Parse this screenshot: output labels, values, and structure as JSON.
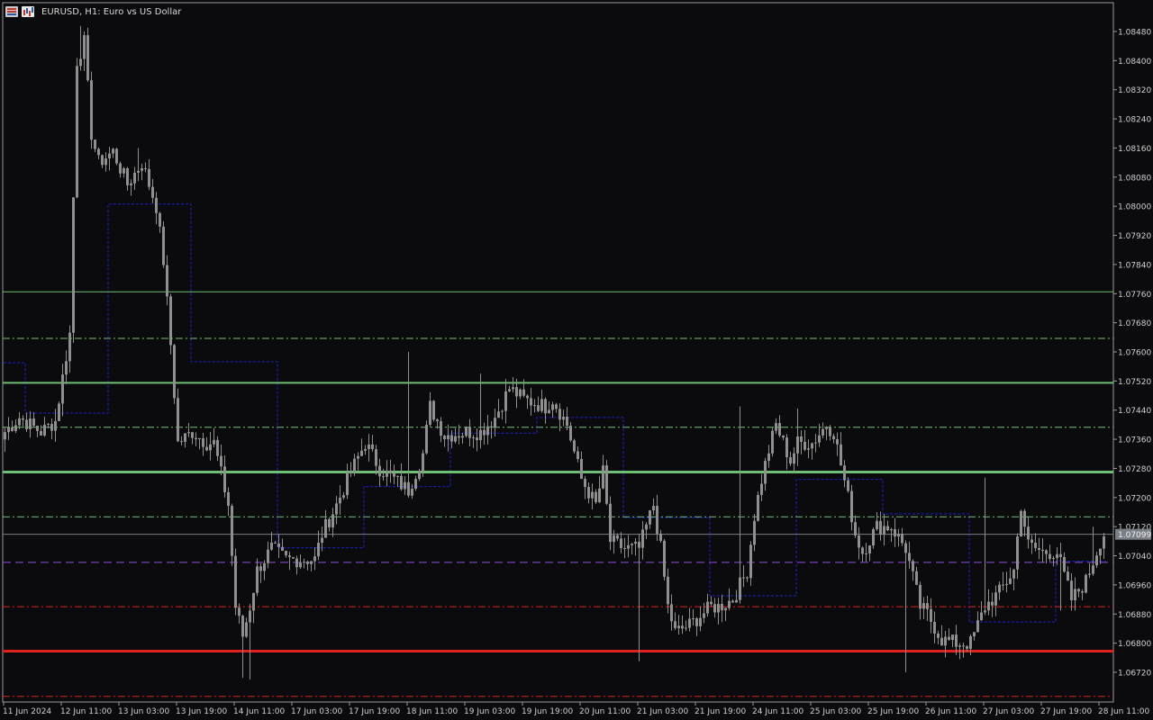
{
  "header": {
    "title": "EURUSD, H1:  Euro vs US Dollar",
    "icons": [
      "list-icon",
      "chart-icon"
    ]
  },
  "colors": {
    "background": "#0b0b0e",
    "axis": "#9a9a9a",
    "text": "#cfcfcf",
    "candle": "#8f8f8f",
    "channel": "#1c22c8",
    "green": "#6fbf73",
    "red": "#e0211d",
    "purple": "#8b4fd6",
    "current_price_line": "#7a7f86"
  },
  "chart_data": {
    "type": "candlestick",
    "symbol": "EURUSD",
    "timeframe": "H1",
    "title": "EURUSD, H1:  Euro vs US Dollar",
    "ylim": [
      1.0666,
      1.0852
    ],
    "y_ticks": [
      "1.08480",
      "1.08400",
      "1.08320",
      "1.08240",
      "1.08160",
      "1.08080",
      "1.08000",
      "1.07920",
      "1.07840",
      "1.07760",
      "1.07680",
      "1.07600",
      "1.07520",
      "1.07440",
      "1.07360",
      "1.07280",
      "1.07200",
      "1.07120",
      "1.07040",
      "1.06960",
      "1.06880",
      "1.06800",
      "1.06720"
    ],
    "x_labels": [
      "11 Jun 2024",
      "12 Jun 11:00",
      "13 Jun 03:00",
      "13 Jun 19:00",
      "14 Jun 11:00",
      "17 Jun 03:00",
      "17 Jun 19:00",
      "18 Jun 11:00",
      "19 Jun 03:00",
      "19 Jun 19:00",
      "20 Jun 11:00",
      "21 Jun 03:00",
      "21 Jun 19:00",
      "24 Jun 11:00",
      "25 Jun 03:00",
      "25 Jun 19:00",
      "26 Jun 11:00",
      "27 Jun 03:00",
      "27 Jun 19:00",
      "28 Jun 11:00"
    ],
    "bars_per_label": 16,
    "total_bars": 306,
    "current_price": 1.07099,
    "current_price_label": "1.07099",
    "levels": [
      {
        "price": 1.07765,
        "color": "#6fbf73",
        "style": "solid",
        "width": 1
      },
      {
        "price": 1.07637,
        "color": "#6fbf73",
        "style": "dashdot",
        "width": 1
      },
      {
        "price": 1.07515,
        "color": "#6fbf73",
        "style": "solid",
        "width": 2
      },
      {
        "price": 1.07393,
        "color": "#6fbf73",
        "style": "dashdot",
        "width": 1
      },
      {
        "price": 1.0727,
        "color": "#6fbf73",
        "style": "solid",
        "width": 3
      },
      {
        "price": 1.07147,
        "color": "#6fbf73",
        "style": "dashdot",
        "width": 1
      },
      {
        "price": 1.07022,
        "color": "#8b4fd6",
        "style": "dashed",
        "width": 1
      },
      {
        "price": 1.069,
        "color": "#e0211d",
        "style": "dashdot",
        "width": 1
      },
      {
        "price": 1.06778,
        "color": "#e0211d",
        "style": "solid",
        "width": 3
      },
      {
        "price": 1.06654,
        "color": "#e0211d",
        "style": "dashdot",
        "width": 1
      }
    ],
    "channel_steps": [
      {
        "from_bar": 0,
        "to_bar": 6,
        "price": 1.0757
      },
      {
        "from_bar": 6,
        "to_bar": 29,
        "price": 1.07432
      },
      {
        "from_bar": 29,
        "to_bar": 52,
        "price": 1.08006
      },
      {
        "from_bar": 52,
        "to_bar": 76,
        "price": 1.07573
      },
      {
        "from_bar": 76,
        "to_bar": 100,
        "price": 1.07062
      },
      {
        "from_bar": 100,
        "to_bar": 124,
        "price": 1.0723
      },
      {
        "from_bar": 124,
        "to_bar": 148,
        "price": 1.07377
      },
      {
        "from_bar": 148,
        "to_bar": 172,
        "price": 1.0742
      },
      {
        "from_bar": 172,
        "to_bar": 196,
        "price": 1.07145
      },
      {
        "from_bar": 196,
        "to_bar": 220,
        "price": 1.0693
      },
      {
        "from_bar": 220,
        "to_bar": 244,
        "price": 1.0725
      },
      {
        "from_bar": 244,
        "to_bar": 268,
        "price": 1.07155
      },
      {
        "from_bar": 268,
        "to_bar": 292,
        "price": 1.06858
      },
      {
        "from_bar": 292,
        "to_bar": 306,
        "price": 1.07025
      }
    ],
    "price_path": [
      [
        0,
        1.0738
      ],
      [
        4,
        1.0742
      ],
      [
        10,
        1.0738
      ],
      [
        14,
        1.0741
      ],
      [
        18,
        1.0765
      ],
      [
        20,
        1.084
      ],
      [
        22,
        1.0845
      ],
      [
        24,
        1.082
      ],
      [
        26,
        1.0812
      ],
      [
        30,
        1.0815
      ],
      [
        34,
        1.0806
      ],
      [
        38,
        1.0812
      ],
      [
        42,
        1.08
      ],
      [
        44,
        1.0785
      ],
      [
        46,
        1.0762
      ],
      [
        48,
        1.0735
      ],
      [
        52,
        1.0738
      ],
      [
        56,
        1.0735
      ],
      [
        58,
        1.0735
      ],
      [
        62,
        1.0718
      ],
      [
        64,
        1.069
      ],
      [
        66,
        1.0682
      ],
      [
        68,
        1.069
      ],
      [
        70,
        1.07
      ],
      [
        74,
        1.0706
      ],
      [
        78,
        1.0703
      ],
      [
        82,
        1.0703
      ],
      [
        86,
        1.0703
      ],
      [
        88,
        1.071
      ],
      [
        92,
        1.0718
      ],
      [
        96,
        1.0727
      ],
      [
        100,
        1.0735
      ],
      [
        104,
        1.0728
      ],
      [
        108,
        1.0725
      ],
      [
        112,
        1.0722
      ],
      [
        116,
        1.0732
      ],
      [
        118,
        1.0745
      ],
      [
        122,
        1.0737
      ],
      [
        128,
        1.0738
      ],
      [
        132,
        1.0738
      ],
      [
        136,
        1.0742
      ],
      [
        140,
        1.075
      ],
      [
        144,
        1.0747
      ],
      [
        150,
        1.0745
      ],
      [
        152,
        1.0747
      ],
      [
        156,
        1.074
      ],
      [
        160,
        1.0725
      ],
      [
        164,
        1.0718
      ],
      [
        166,
        1.0727
      ],
      [
        168,
        1.0708
      ],
      [
        172,
        1.0706
      ],
      [
        176,
        1.0706
      ],
      [
        178,
        1.0712
      ],
      [
        180,
        1.0718
      ],
      [
        182,
        1.0706
      ],
      [
        184,
        1.069
      ],
      [
        186,
        1.0683
      ],
      [
        190,
        1.0685
      ],
      [
        196,
        1.069
      ],
      [
        198,
        1.069
      ],
      [
        202,
        1.0692
      ],
      [
        206,
        1.07
      ],
      [
        208,
        1.0715
      ],
      [
        210,
        1.0725
      ],
      [
        212,
        1.0733
      ],
      [
        214,
        1.074
      ],
      [
        216,
        1.0735
      ],
      [
        218,
        1.073
      ],
      [
        220,
        1.0735
      ],
      [
        224,
        1.0735
      ],
      [
        228,
        1.074
      ],
      [
        230,
        1.0738
      ],
      [
        234,
        1.072
      ],
      [
        236,
        1.071
      ],
      [
        238,
        1.0705
      ],
      [
        242,
        1.0712
      ],
      [
        246,
        1.0712
      ],
      [
        250,
        1.0706
      ],
      [
        254,
        1.069
      ],
      [
        256,
        1.0688
      ],
      [
        260,
        1.0681
      ],
      [
        264,
        1.068
      ],
      [
        268,
        1.068
      ],
      [
        272,
        1.069
      ],
      [
        276,
        1.0694
      ],
      [
        280,
        1.07
      ],
      [
        282,
        1.0718
      ],
      [
        284,
        1.0707
      ],
      [
        288,
        1.0705
      ],
      [
        292,
        1.0705
      ],
      [
        296,
        1.0692
      ],
      [
        300,
        1.0697
      ],
      [
        304,
        1.0708
      ],
      [
        305,
        1.071
      ]
    ],
    "wick_extremes": [
      {
        "bar": 21,
        "price": 1.08495
      },
      {
        "bar": 19,
        "price": 1.07625
      },
      {
        "bar": 37,
        "price": 1.0816
      },
      {
        "bar": 66,
        "price": 1.06705
      },
      {
        "bar": 68,
        "price": 1.067
      },
      {
        "bar": 112,
        "price": 1.076
      },
      {
        "bar": 132,
        "price": 1.0754
      },
      {
        "bar": 146,
        "price": 1.0749
      },
      {
        "bar": 176,
        "price": 1.0675
      },
      {
        "bar": 204,
        "price": 1.0745
      },
      {
        "bar": 220,
        "price": 1.07445
      },
      {
        "bar": 250,
        "price": 1.0672
      },
      {
        "bar": 272,
        "price": 1.07255
      },
      {
        "bar": 293,
        "price": 1.0689
      },
      {
        "bar": 302,
        "price": 1.0712
      }
    ]
  }
}
